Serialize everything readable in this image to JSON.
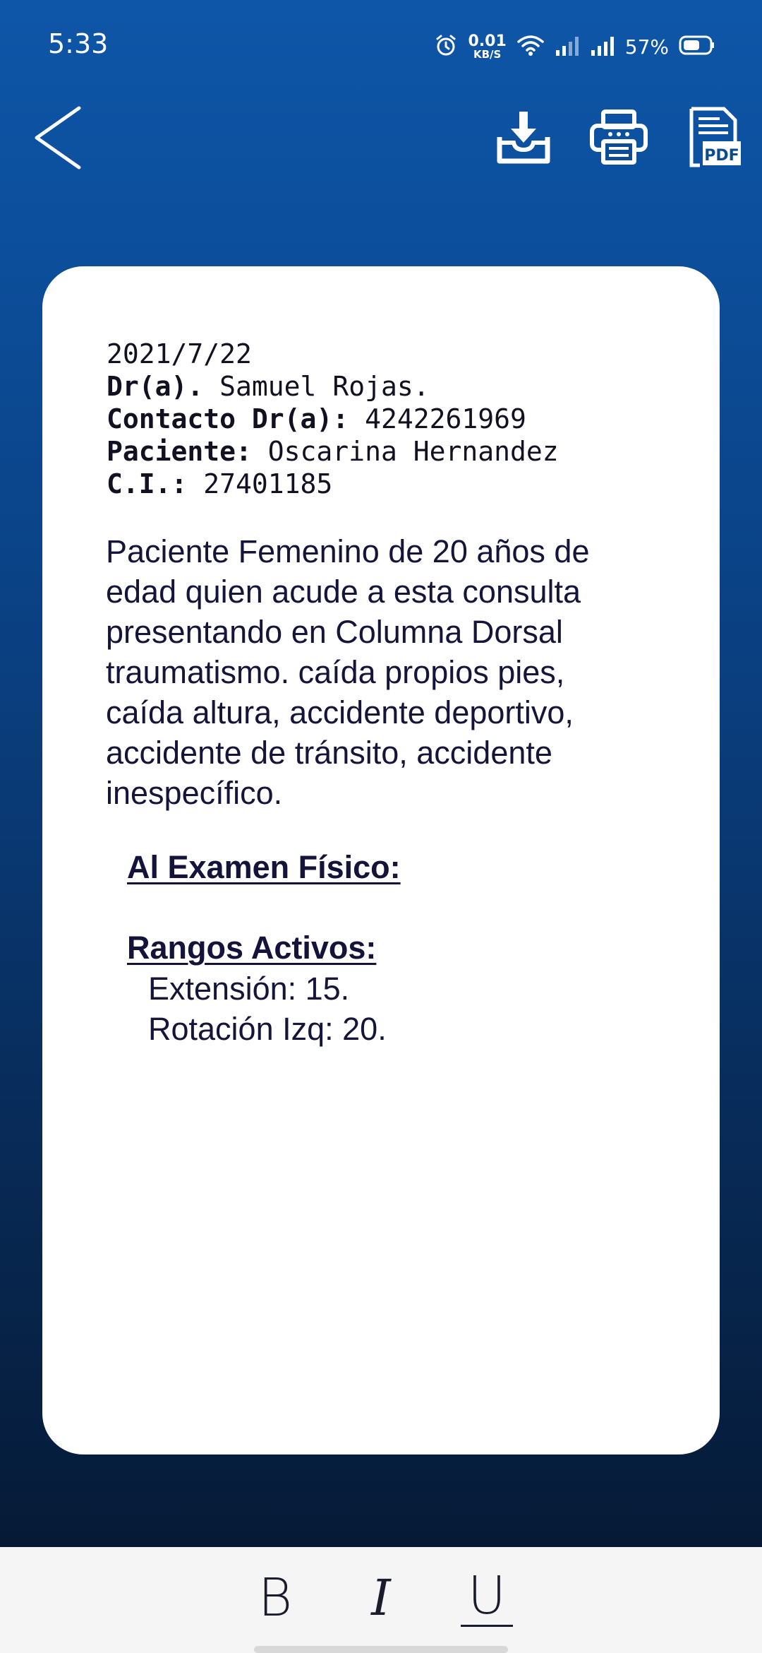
{
  "status_bar": {
    "time": "5:33",
    "speed_value": "0.01",
    "speed_unit": "KB/S",
    "battery_percent": "57%",
    "icons": [
      "alarm-icon",
      "wifi-icon",
      "signal-icon",
      "signal-icon",
      "battery-icon"
    ]
  },
  "toolbar": {
    "icons": [
      "back-arrow-icon",
      "download-icon",
      "printer-icon",
      "pdf-icon"
    ],
    "pdf_icon_text": "PDF"
  },
  "report": {
    "date": "2021/7/22",
    "doctor_label": "Dr(a).",
    "doctor_name": "Samuel Rojas.",
    "contact_label": "Contacto Dr(a):",
    "contact_value": "4242261969",
    "patient_label": "Paciente:",
    "patient_name": "Oscarina Hernandez",
    "id_label": "C.I.:",
    "id_value": "27401185",
    "paragraph": "Paciente Femenino de 20 años de edad quien acude a esta consulta presentando en Columna Dorsal traumatismo. caída propios pies, caída altura, accidente deportivo, accidente de tránsito, accidente inespecífico.",
    "exam_title": "Al Examen Físico:",
    "ranges_title": "Rangos Activos:",
    "ranges": [
      "Extensión: 15.",
      "Rotación Izq: 20."
    ]
  },
  "editor": {
    "bold_label": "B",
    "italic_label": "I",
    "underline_label": "U"
  },
  "colors": {
    "gradient_top": "#0e56a8",
    "gradient_bottom": "#061a36",
    "card": "#ffffff",
    "text": "#15153a",
    "editor_bar": "#f5f5f5"
  }
}
